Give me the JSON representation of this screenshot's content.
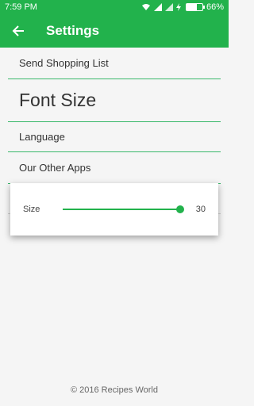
{
  "statusbar": {
    "time": "7:59 PM",
    "battery_percent": 66,
    "battery_label": "66%",
    "icons": [
      "wifi-icon",
      "signal-icon",
      "signal-icon-2",
      "charging-icon",
      "battery-icon"
    ]
  },
  "appbar": {
    "back_icon": "arrow-left-icon",
    "title": "Settings",
    "color": "#22b24c"
  },
  "settings": {
    "items": [
      {
        "label": "Send Shopping List"
      },
      {
        "label": "Font Size"
      },
      {
        "label": "Language"
      },
      {
        "label": "Our Other Apps"
      },
      {
        "label": ""
      }
    ]
  },
  "dialog": {
    "label": "Size",
    "value": "30",
    "slider_fraction": 1.0
  },
  "footer": {
    "text": "© 2016 Recipes World"
  }
}
